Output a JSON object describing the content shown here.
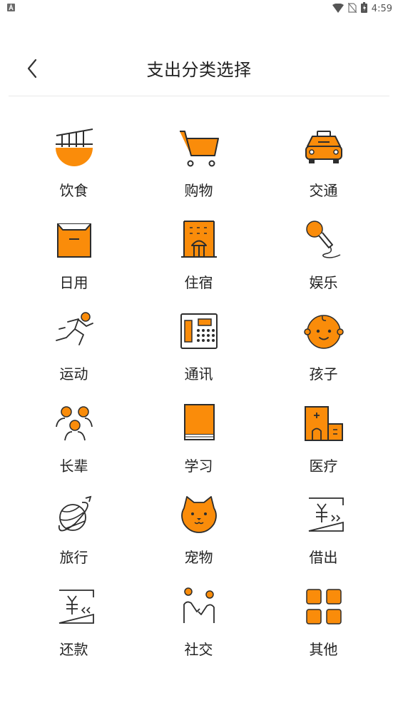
{
  "status_bar": {
    "time": "4:59"
  },
  "header": {
    "title": "支出分类选择"
  },
  "colors": {
    "accent": "#fa8c0a",
    "stroke": "#2d2d2d"
  },
  "categories": [
    {
      "label": "饮食",
      "icon": "food-bowl-icon"
    },
    {
      "label": "购物",
      "icon": "shopping-cart-icon"
    },
    {
      "label": "交通",
      "icon": "taxi-icon"
    },
    {
      "label": "日用",
      "icon": "box-icon"
    },
    {
      "label": "住宿",
      "icon": "hotel-icon"
    },
    {
      "label": "娱乐",
      "icon": "microphone-icon"
    },
    {
      "label": "运动",
      "icon": "running-icon"
    },
    {
      "label": "通讯",
      "icon": "phone-icon"
    },
    {
      "label": "孩子",
      "icon": "baby-face-icon"
    },
    {
      "label": "长辈",
      "icon": "elders-icon"
    },
    {
      "label": "学习",
      "icon": "book-icon"
    },
    {
      "label": "医疗",
      "icon": "hospital-icon"
    },
    {
      "label": "旅行",
      "icon": "planet-icon"
    },
    {
      "label": "宠物",
      "icon": "pet-icon"
    },
    {
      "label": "借出",
      "icon": "lend-icon"
    },
    {
      "label": "还款",
      "icon": "repay-icon"
    },
    {
      "label": "社交",
      "icon": "social-icon"
    },
    {
      "label": "其他",
      "icon": "other-grid-icon"
    }
  ]
}
